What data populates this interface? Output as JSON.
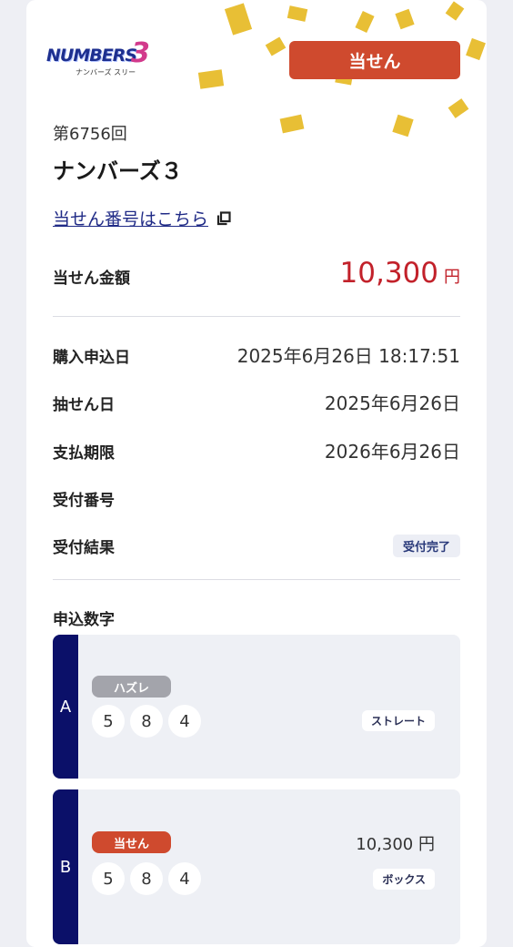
{
  "status_banner": "当せん",
  "logo": {
    "text": "NUMBERS",
    "digit": "3",
    "sub": "ナンバーズ スリー"
  },
  "draw": {
    "number": "第6756回",
    "game_name": "ナンバーズ３"
  },
  "result_link": "当せん番号はこちら",
  "prize": {
    "label": "当せん金額",
    "amount": "10,300",
    "unit": "円"
  },
  "details": {
    "purchase_date": {
      "label": "購入申込日",
      "value": "2025年6月26日 18:17:51"
    },
    "draw_date": {
      "label": "抽せん日",
      "value": "2025年6月26日"
    },
    "payment_deadline": {
      "label": "支払期限",
      "value": "2026年6月26日"
    },
    "receipt_number": {
      "label": "受付番号",
      "value": ""
    },
    "receipt_result": {
      "label": "受付結果",
      "value": "受付完了"
    }
  },
  "entries_title": "申込数字",
  "entries": [
    {
      "tab": "A",
      "tag": "ハズレ",
      "numbers": [
        "5",
        "8",
        "4"
      ],
      "type": "ストレート",
      "amount": ""
    },
    {
      "tab": "B",
      "tag": "当せん",
      "numbers": [
        "5",
        "8",
        "4"
      ],
      "type": "ボックス",
      "amount": "10,300 円"
    }
  ],
  "colors": {
    "win": "#cf4a2e",
    "lose": "#a3a4ab",
    "prize": "#c2212a",
    "navy": "#0b1069",
    "confetti": "#e8bf35"
  }
}
